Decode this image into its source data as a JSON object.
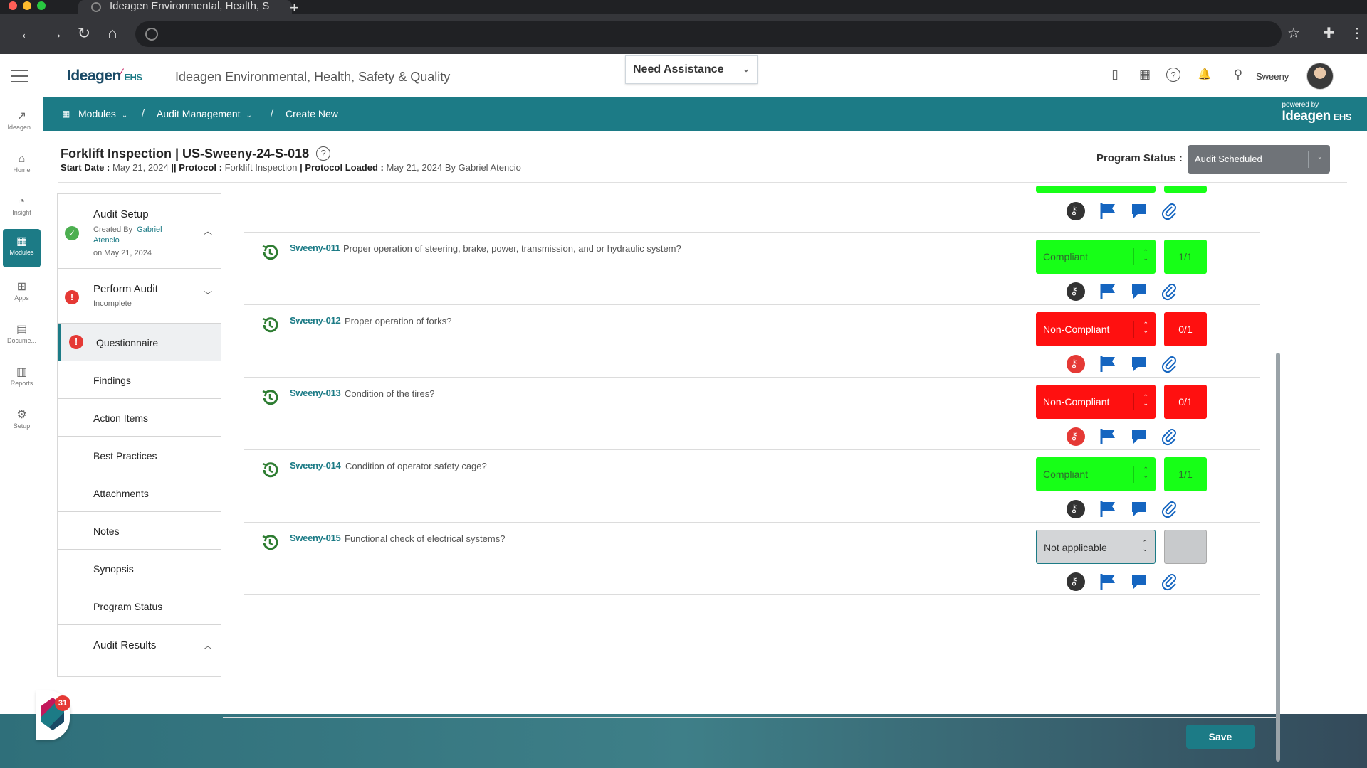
{
  "browser": {
    "tab_title": "Ideagen Environmental, Health, S",
    "new_tab": "+",
    "back": "←",
    "forward": "→",
    "reload": "↻",
    "home": "⌂",
    "star": "☆",
    "extensions": "✚",
    "menu": "⋮"
  },
  "leftnav": {
    "items": [
      {
        "label": "Ideagen...",
        "icon": "↗"
      },
      {
        "label": "Home",
        "icon": "⌂"
      },
      {
        "label": "Insight",
        "icon": "◔"
      },
      {
        "label": "Modules",
        "icon": "▦"
      },
      {
        "label": "Apps",
        "icon": "⊞"
      },
      {
        "label": "Docume...",
        "icon": "▤"
      },
      {
        "label": "Reports",
        "icon": "▥"
      },
      {
        "label": "Setup",
        "icon": "⚙"
      }
    ]
  },
  "header": {
    "logo_text": "Ideagen",
    "logo_mark": "⁄",
    "logo_suffix": "EHS",
    "app_title": "Ideagen Environmental, Health, Safety & Quality",
    "assist_label": "Need Assistance",
    "assist_chev": "⌄",
    "icons": {
      "mobile": "▯",
      "calendar": "▦",
      "help": "?",
      "bell": "🔔",
      "location": "⚲"
    },
    "user_name": "Sweeny"
  },
  "breadcrumb": {
    "modules": "Modules",
    "audit_management": "Audit Management",
    "create_new": "Create New",
    "separator": "/",
    "dropdown": "⌄",
    "powered_by": "powered by",
    "powered_logo": "Ideagen",
    "powered_suffix": "EHS"
  },
  "page": {
    "title": "Forklift Inspection | US-Sweeny-24-S-018",
    "help": "?",
    "start_date_label": "Start Date :",
    "start_date": "May 21, 2024",
    "sep": "||",
    "protocol_label": "Protocol :",
    "protocol": "Forklift Inspection",
    "pipe": "|",
    "protocol_loaded_label": "Protocol Loaded :",
    "protocol_loaded": "May 21, 2024 By Gabriel Atencio",
    "program_status_label": "Program Status :",
    "program_status": "Audit Scheduled"
  },
  "subnav": {
    "audit_setup": {
      "title": "Audit Setup",
      "created_by": "Created By",
      "creator": "Gabriel Atencio",
      "date": "on May 21, 2024"
    },
    "perform_audit": {
      "title": "Perform Audit",
      "status": "Incomplete"
    },
    "items": [
      "Questionnaire",
      "Findings",
      "Action Items",
      "Best Practices",
      "Attachments",
      "Notes",
      "Synopsis",
      "Program Status"
    ],
    "audit_results": "Audit Results",
    "badge_count": "31"
  },
  "questions": [
    {
      "id": "Sweeny-011",
      "text": "Proper operation of steering, brake, power, transmission, and or hydraulic system?",
      "status": "Compliant",
      "score": "1/1",
      "state": "green"
    },
    {
      "id": "Sweeny-012",
      "text": "Proper operation of forks?",
      "status": "Non-Compliant",
      "score": "0/1",
      "state": "red"
    },
    {
      "id": "Sweeny-013",
      "text": "Condition of the tires?",
      "status": "Non-Compliant",
      "score": "0/1",
      "state": "red"
    },
    {
      "id": "Sweeny-014",
      "text": "Condition of operator safety cage?",
      "status": "Compliant",
      "score": "1/1",
      "state": "green"
    },
    {
      "id": "Sweeny-015",
      "text": "Functional check of electrical systems?",
      "status": "Not applicable",
      "score": "",
      "state": "na"
    }
  ],
  "save_label": "Save",
  "colors": {
    "teal": "#1c7b86",
    "compliant": "#17ff17",
    "noncompliant": "#ff1010",
    "na": "#d3d5d7",
    "flag": "#1565c0"
  }
}
